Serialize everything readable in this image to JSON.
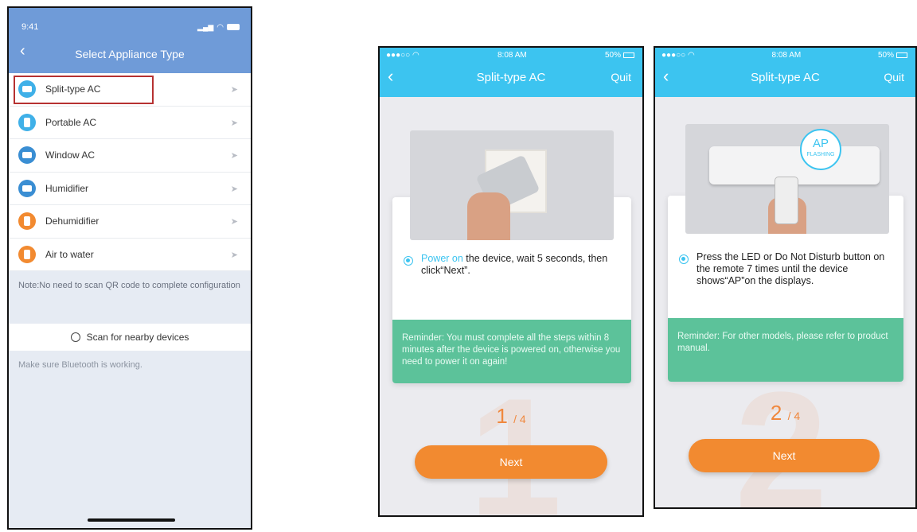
{
  "phone1": {
    "time": "9:41",
    "title": "Select Appliance Type",
    "items": [
      {
        "label": "Split-type AC",
        "color": "#3fb0e8"
      },
      {
        "label": "Portable AC",
        "color": "#3fb0e8"
      },
      {
        "label": "Window AC",
        "color": "#3a8ed3"
      },
      {
        "label": "Humidifier",
        "color": "#3a8ed3"
      },
      {
        "label": "Dehumidifier",
        "color": "#f28a30"
      },
      {
        "label": "Air to water",
        "color": "#f28a30"
      }
    ],
    "note": "Note:No need to scan QR code to complete configuration",
    "scan_label": "Scan for nearby devices",
    "bluetooth_note": "Make sure Bluetooth is working."
  },
  "phone2": {
    "time": "8:08 AM",
    "battery": "50%",
    "title": "Split-type AC",
    "quit": "Quit",
    "instruction_highlight": "Power on",
    "instruction_rest": " the device, wait 5 seconds, then click“Next”.",
    "reminder": "Reminder: You must complete all the steps within 8 minutes after the device is powered on, otherwise you need to power it on again!",
    "step_num": "1",
    "step_total": "/ 4",
    "big_number": "1",
    "next": "Next"
  },
  "phone3": {
    "time": "8:08 AM",
    "battery": "50%",
    "title": "Split-type AC",
    "quit": "Quit",
    "ap_label": "AP",
    "ap_sub": "FLASHING",
    "instruction": "Press the LED or Do Not Disturb button on the remote 7 times until the device shows“AP”on the displays.",
    "reminder": "Reminder: For other models, please refer to product manual.",
    "step_num": "2",
    "step_total": "/ 4",
    "big_number": "2",
    "next": "Next"
  }
}
